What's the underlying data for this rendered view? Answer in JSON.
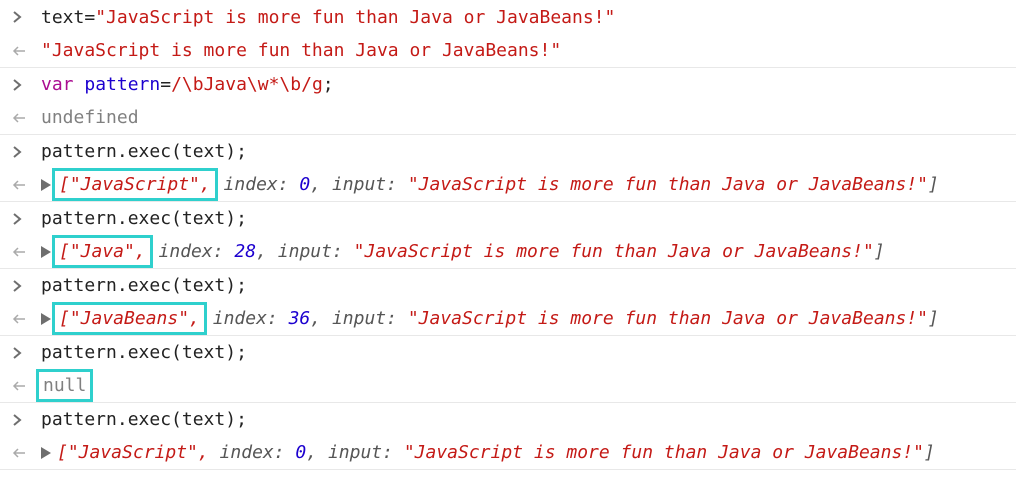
{
  "console": {
    "entries": [
      {
        "input": {
          "parts": [
            "text=",
            "\"JavaScript is more fun than Java or JavaBeans!\""
          ]
        },
        "output": {
          "text": "\"JavaScript is more fun than Java or JavaBeans!\""
        }
      },
      {
        "input": {
          "parts": [
            "var",
            " pattern",
            "=",
            "/\\bJava\\w*\\b/g",
            ";"
          ]
        },
        "output": {
          "text": "undefined"
        }
      },
      {
        "input": {
          "text": "pattern.exec(text);"
        },
        "output": {
          "match": "[\"JavaScript\",",
          "index_key": " index: ",
          "index": "0",
          "input_key": ", input: ",
          "input": "\"JavaScript is more fun than Java or JavaBeans!\"",
          "close": "]"
        }
      },
      {
        "input": {
          "text": "pattern.exec(text);"
        },
        "output": {
          "match": "[\"Java\",",
          "index_key": " index: ",
          "index": "28",
          "input_key": ", input: ",
          "input": "\"JavaScript is more fun than Java or JavaBeans!\"",
          "close": "]"
        }
      },
      {
        "input": {
          "text": "pattern.exec(text);"
        },
        "output": {
          "match": "[\"JavaBeans\",",
          "index_key": " index: ",
          "index": "36",
          "input_key": ", input: ",
          "input": "\"JavaScript is more fun than Java or JavaBeans!\"",
          "close": "]"
        }
      },
      {
        "input": {
          "text": "pattern.exec(text);"
        },
        "output": {
          "text": "null"
        }
      },
      {
        "input": {
          "text": "pattern.exec(text);"
        },
        "output": {
          "match": "[\"JavaScript\",",
          "index_key": " index: ",
          "index": "0",
          "input_key": ", input: ",
          "input": "\"JavaScript is more fun than Java or JavaBeans!\"",
          "close": "]"
        }
      }
    ]
  },
  "icons": {
    "input_prompt": "chevron-right-icon",
    "output_prompt": "return-arrow-icon",
    "expand": "triangle-right-icon"
  },
  "colors": {
    "highlight": "#2fd0cd",
    "string": "#c41a16",
    "number": "#1c00cf",
    "keyword": "#aa0d91"
  }
}
